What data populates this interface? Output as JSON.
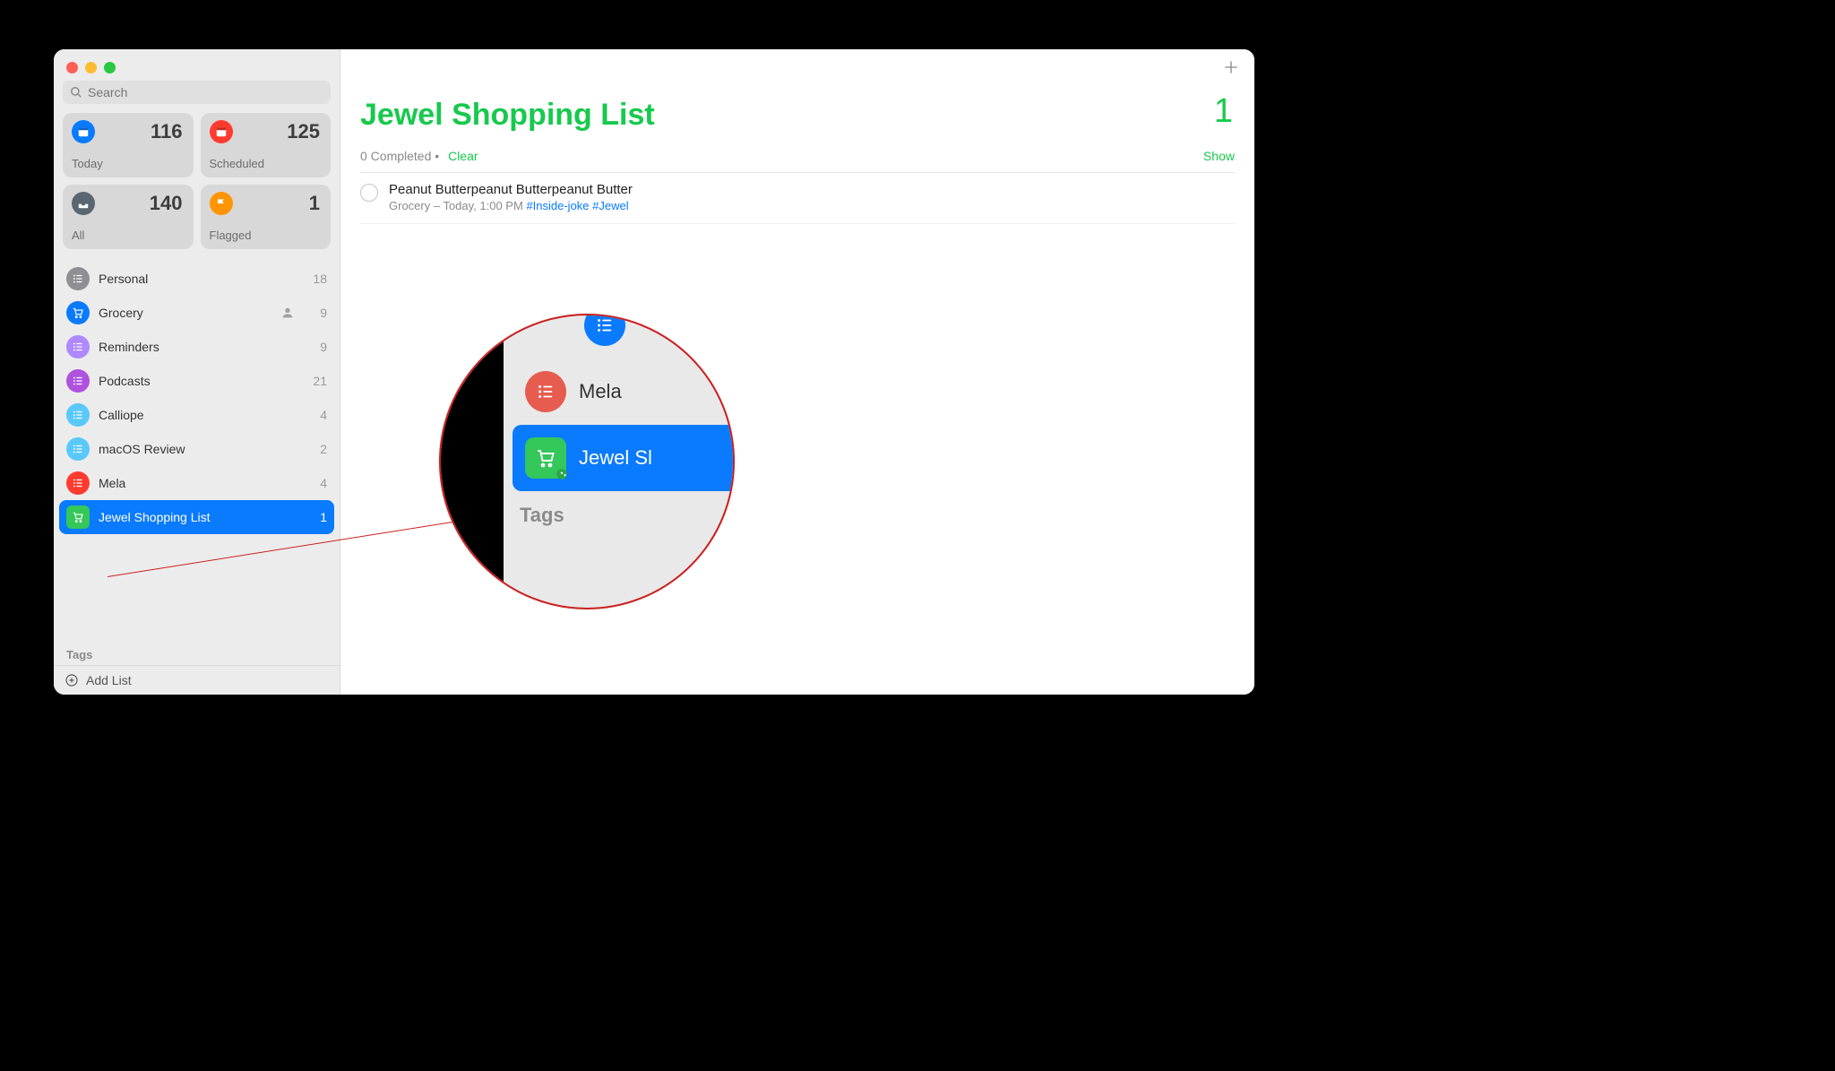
{
  "colors": {
    "accent": "#17c94d",
    "blue": "#0a7aff",
    "red": "#ff3b30",
    "orange": "#ff9500",
    "gray": "#5b6770",
    "grayIcon": "#8e8e93",
    "purple": "#af52de",
    "lightblue": "#5ac8fa",
    "redlist": "#ff3b30",
    "green": "#34c759"
  },
  "search": {
    "placeholder": "Search"
  },
  "smart": {
    "today": {
      "label": "Today",
      "count": "116"
    },
    "scheduled": {
      "label": "Scheduled",
      "count": "125"
    },
    "all": {
      "label": "All",
      "count": "140"
    },
    "flagged": {
      "label": "Flagged",
      "count": "1"
    }
  },
  "lists": [
    {
      "name": "Personal",
      "count": "18",
      "color": "#8e8e93",
      "icon": "list",
      "shared": false,
      "selected": false
    },
    {
      "name": "Grocery",
      "count": "9",
      "color": "#0a7aff",
      "icon": "cart",
      "shared": true,
      "selected": false
    },
    {
      "name": "Reminders",
      "count": "9",
      "color": "#af89ff",
      "icon": "list",
      "shared": false,
      "selected": false
    },
    {
      "name": "Podcasts",
      "count": "21",
      "color": "#af52de",
      "icon": "list",
      "shared": false,
      "selected": false
    },
    {
      "name": "Calliope",
      "count": "4",
      "color": "#5ac8fa",
      "icon": "list",
      "shared": false,
      "selected": false
    },
    {
      "name": "macOS Review",
      "count": "2",
      "color": "#5ac8fa",
      "icon": "list",
      "shared": false,
      "selected": false
    },
    {
      "name": "Mela",
      "count": "4",
      "color": "#ff3b30",
      "icon": "list",
      "shared": false,
      "selected": false
    },
    {
      "name": "Jewel Shopping List",
      "count": "1",
      "color": "#34c759",
      "icon": "cart-smart",
      "shared": false,
      "selected": true
    }
  ],
  "tagsHeader": "Tags",
  "footer": {
    "addList": "Add List"
  },
  "main": {
    "title": "Jewel Shopping List",
    "count": "1",
    "completedText": "0 Completed",
    "dot": "•",
    "clear": "Clear",
    "show": "Show"
  },
  "reminder": {
    "title": "Peanut Butterpeanut Butterpeanut Butter",
    "metaPrefix": "Grocery – Today, 1:00 PM ",
    "tag1": "#Inside-joke",
    "tag2": "#Jewel"
  },
  "magnifier": {
    "mela": "Mela",
    "jewel": "Jewel Sl",
    "tags": "Tags"
  }
}
